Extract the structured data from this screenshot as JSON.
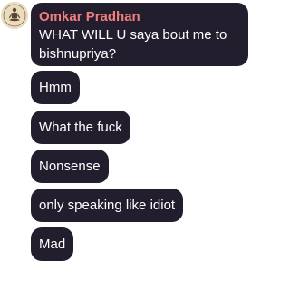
{
  "chat": {
    "sender_name": "Omkar Pradhan",
    "avatar_icon": "meditating-figure-icon",
    "colors": {
      "bubble_bg": "#231e2e",
      "bubble_text": "#ffffff",
      "sender_name": "#f17e7e"
    },
    "messages": [
      {
        "text": "WHAT WILL U saya bout me to bishnupriya?"
      },
      {
        "text": "Hmm"
      },
      {
        "text": "What the fuck"
      },
      {
        "text": "Nonsense"
      },
      {
        "text": "only speaking like idiot"
      },
      {
        "text": "Mad"
      }
    ]
  }
}
